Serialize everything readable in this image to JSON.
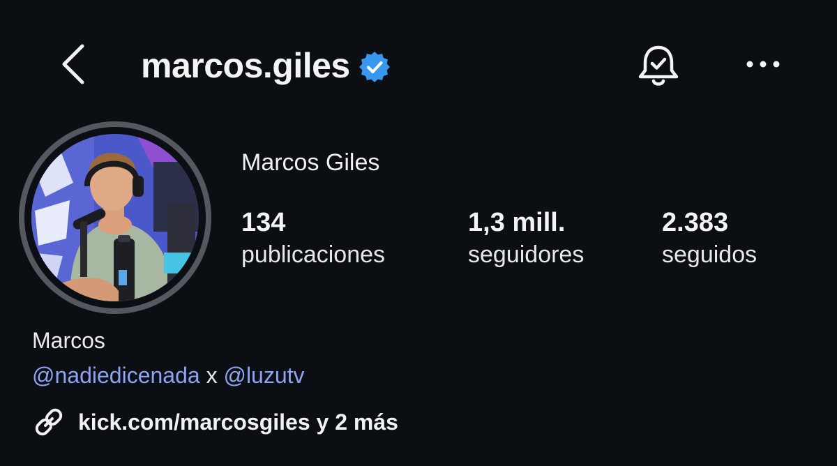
{
  "header": {
    "username": "marcos.giles",
    "back_icon": "chevron-left-icon",
    "verified_icon": "verified-badge-icon",
    "notifications_icon": "bell-check-icon",
    "more_icon": "more-horizontal-icon"
  },
  "profile": {
    "display_name": "Marcos Giles",
    "stats": {
      "posts": {
        "value": "134",
        "label": "publicaciones"
      },
      "followers": {
        "value": "1,3 mill.",
        "label": "seguidores"
      },
      "following": {
        "value": "2.383",
        "label": "seguidos"
      }
    }
  },
  "bio": {
    "name": "Marcos",
    "mention_1": "@nadiedicenada",
    "separator": "x",
    "mention_2": "@luzutv",
    "link_icon": "link-icon",
    "link_text": "kick.com/marcosgiles y 2 más"
  },
  "colors": {
    "background": "#0b0e13",
    "verified": "#3897f0",
    "mention": "#8fa3f3",
    "avatar_ring": "#55595f"
  }
}
